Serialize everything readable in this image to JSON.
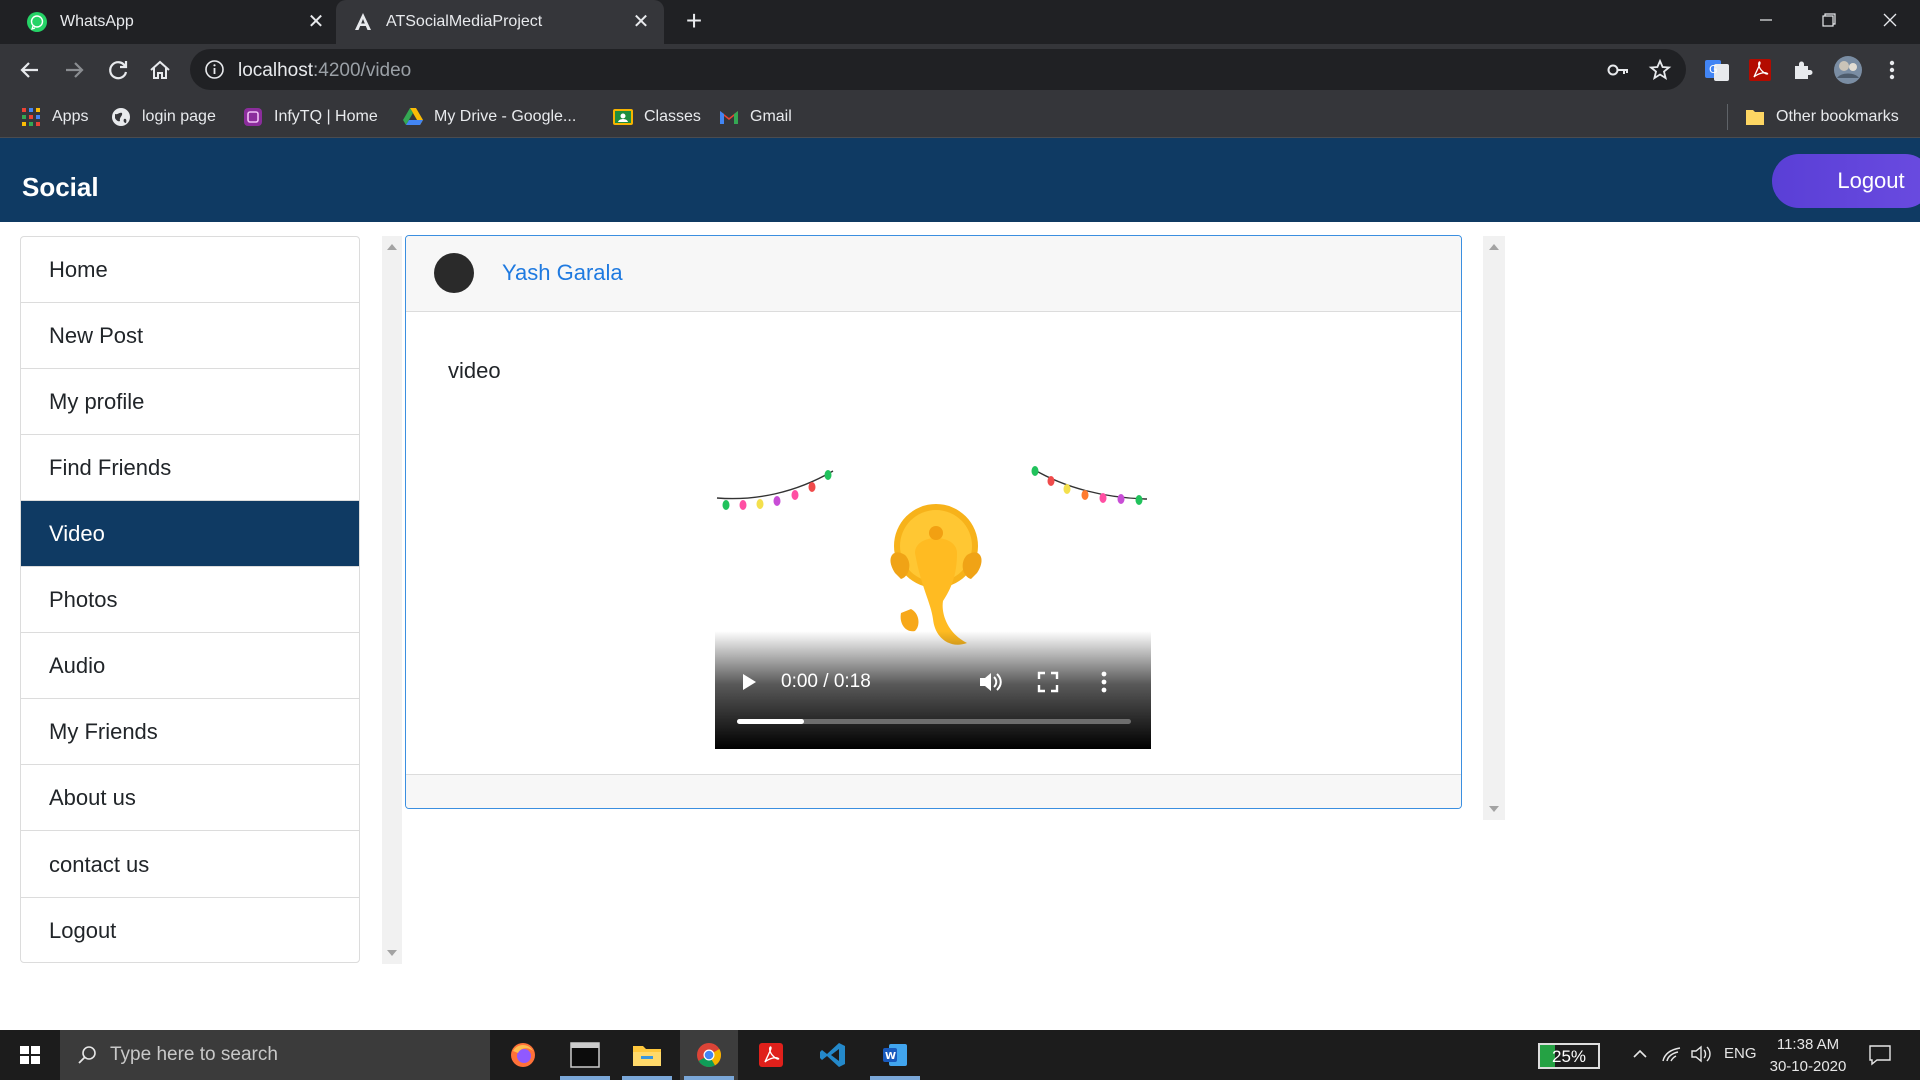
{
  "browser": {
    "tabs": [
      {
        "title": "WhatsApp",
        "icon": "whatsapp-icon",
        "active": false
      },
      {
        "title": "ATSocialMediaProject",
        "icon": "angular-icon",
        "active": true
      }
    ],
    "url_host": "localhost",
    "url_path": ":4200/video",
    "bookmarks": [
      {
        "label": "Apps",
        "icon": "apps-grid-icon"
      },
      {
        "label": "login page",
        "icon": "globe-icon"
      },
      {
        "label": "InfyTQ | Home",
        "icon": "infytq-icon"
      },
      {
        "label": "My Drive - Google...",
        "icon": "google-drive-icon"
      },
      {
        "label": "Classes",
        "icon": "google-classroom-icon"
      },
      {
        "label": "Gmail",
        "icon": "gmail-icon"
      }
    ],
    "other_bookmarks": "Other bookmarks"
  },
  "app": {
    "brand": "Social",
    "logout_button": "Logout",
    "nav": [
      {
        "label": "Home",
        "active": false
      },
      {
        "label": "New Post",
        "active": false
      },
      {
        "label": "My profile",
        "active": false
      },
      {
        "label": "Find Friends",
        "active": false
      },
      {
        "label": "Video",
        "active": true
      },
      {
        "label": "Photos",
        "active": false
      },
      {
        "label": "Audio",
        "active": false
      },
      {
        "label": "My Friends",
        "active": false
      },
      {
        "label": "About us",
        "active": false
      },
      {
        "label": "contact us",
        "active": false
      },
      {
        "label": "Logout",
        "active": false
      }
    ],
    "post": {
      "author": "Yash Garala",
      "text": "video",
      "video": {
        "time": "0:00 / 0:18",
        "buffered_fraction": 0.17
      }
    }
  },
  "taskbar": {
    "search_placeholder": "Type here to search",
    "battery": "25%",
    "battery_level": 0.25,
    "language": "ENG",
    "time": "11:38 AM",
    "date": "30-10-2020"
  },
  "colors": {
    "header": "#0f3a63",
    "active_nav": "#0f3a63",
    "logout_gradient": "#5a3fd6",
    "author_link": "#1f7ae0",
    "card_border": "#3b8fe0"
  }
}
